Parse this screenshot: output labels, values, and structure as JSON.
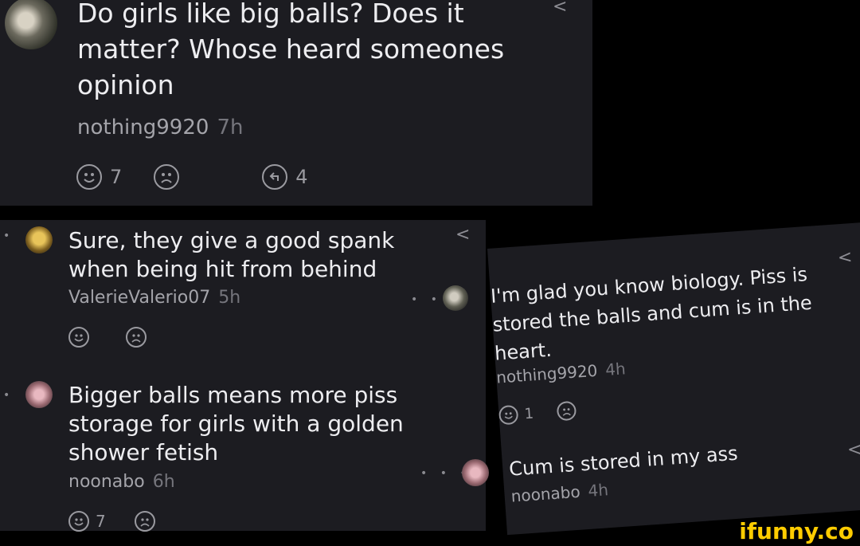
{
  "top_post": {
    "text": "Do girls like big balls? Does it matter? Whose heard someones opinion",
    "author": "nothing9920",
    "time": "7h",
    "smile_count": "7",
    "reply_count": "4"
  },
  "comment_1": {
    "text": "Sure, they give a good spank when being hit from behind",
    "author": "ValerieValerio07",
    "time": "5h"
  },
  "comment_2": {
    "text": "Bigger balls means more piss storage for girls with a golden shower fetish",
    "author": "noonabo",
    "time": "6h",
    "smile_count": "7"
  },
  "comment_3": {
    "text": "I'm glad you know biology. Piss is stored the balls and cum is in the heart.",
    "author": "nothing9920",
    "time": "4h",
    "smile_count": "1"
  },
  "comment_4": {
    "text": "Cum is stored in my ass",
    "author": "noonabo",
    "time": "4h"
  },
  "watermark": "ifunny.co",
  "colors": {
    "panel": "#1c1c21",
    "background": "#000000",
    "watermark": "#ffcc00"
  }
}
